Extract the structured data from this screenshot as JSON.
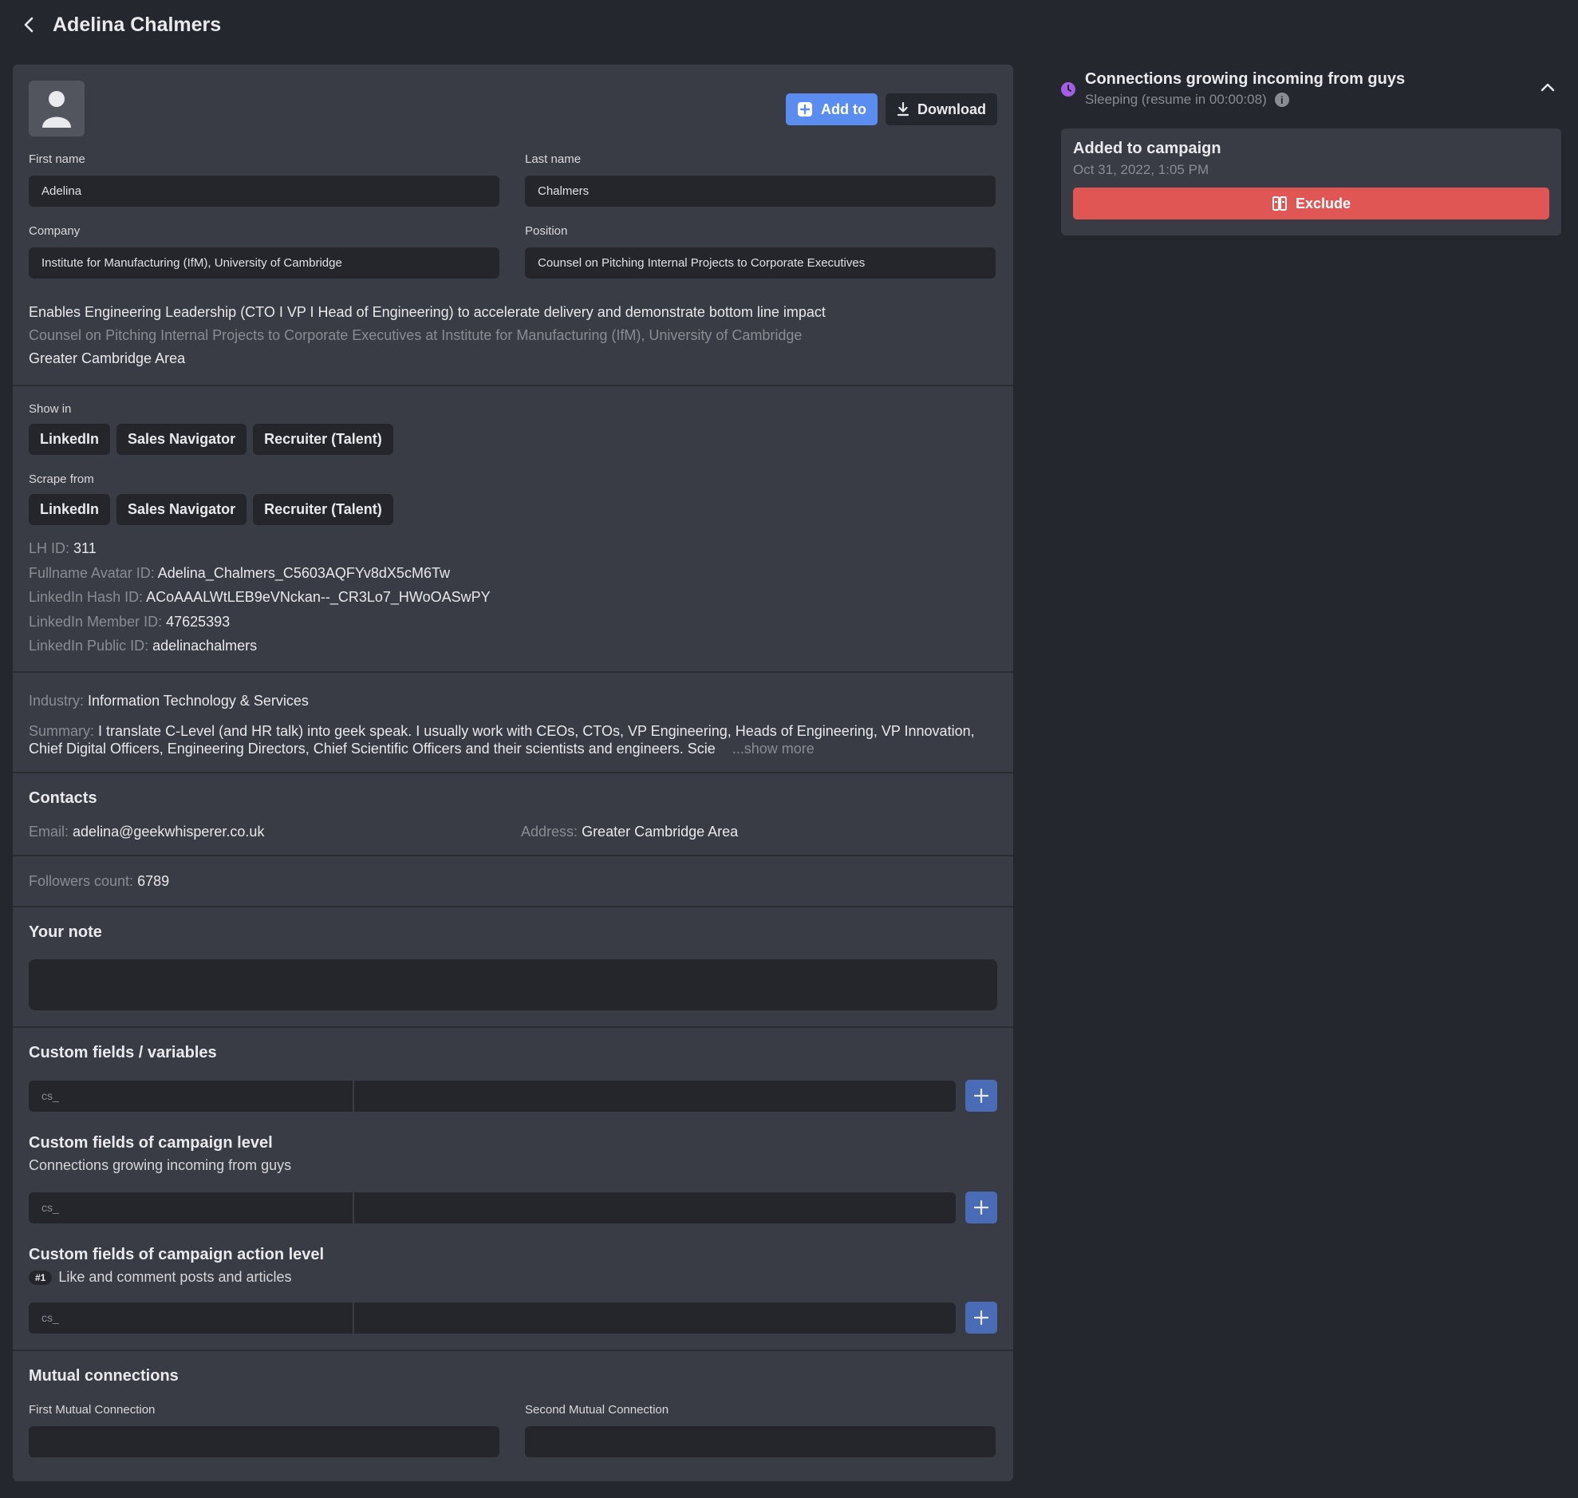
{
  "header": {
    "title": "Adelina Chalmers"
  },
  "profile": {
    "buttons": {
      "add_to": "Add to",
      "download": "Download"
    },
    "first_name": {
      "label": "First name",
      "value": "Adelina"
    },
    "last_name": {
      "label": "Last name",
      "value": "Chalmers"
    },
    "company": {
      "label": "Company",
      "value": "Institute for Manufacturing (IfM), University of Cambridge"
    },
    "position": {
      "label": "Position",
      "value": "Counsel  on Pitching Internal Projects to Corporate Executives"
    },
    "headline": "Enables Engineering Leadership (CTO I VP I Head of Engineering) to accelerate delivery and demonstrate bottom line impact",
    "subheadline": "Counsel on Pitching Internal Projects to Corporate Executives at Institute for Manufacturing (IfM), University of Cambridge",
    "location": "Greater Cambridge Area"
  },
  "show_in": {
    "label": "Show in",
    "tags": [
      "LinkedIn",
      "Sales Navigator",
      "Recruiter (Talent)"
    ]
  },
  "scrape_from": {
    "label": "Scrape from",
    "tags": [
      "LinkedIn",
      "Sales Navigator",
      "Recruiter (Talent)"
    ]
  },
  "ids": [
    {
      "key": "LH ID:",
      "value": "311"
    },
    {
      "key": "Fullname Avatar ID:",
      "value": "Adelina_Chalmers_C5603AQFYv8dX5cM6Tw"
    },
    {
      "key": "LinkedIn Hash ID:",
      "value": "ACoAAALWtLEB9eVNckan--_CR3Lo7_HWoOASwPY"
    },
    {
      "key": "LinkedIn Member ID:",
      "value": "47625393"
    },
    {
      "key": "LinkedIn Public ID:",
      "value": "adelinachalmers"
    }
  ],
  "industry": {
    "key": "Industry:",
    "value": "Information Technology & Services"
  },
  "summary": {
    "key": "Summary:",
    "value": "I translate C-Level (and HR talk) into geek speak. I usually work with CEOs, CTOs, VP Engineering, Heads of Engineering, VP Innovation, Chief Digital Officers, Engineering Directors, Chief Scientific Officers and their scientists and engineers. Scie",
    "show_more": "...show more"
  },
  "contacts": {
    "title": "Contacts",
    "email_key": "Email:",
    "email": "adelina@geekwhisperer.co.uk",
    "address_key": "Address:",
    "address": "Greater Cambridge Area"
  },
  "followers": {
    "key": "Followers count:",
    "value": "6789"
  },
  "note": {
    "title": "Your note"
  },
  "custom_fields": {
    "title": "Custom fields / variables",
    "key_placeholder": "cs_",
    "campaign_title": "Custom fields of campaign level",
    "campaign_name": "Connections growing incoming from guys",
    "action_title": "Custom fields of campaign action level",
    "action_badge": "#1",
    "action_name": "Like and comment posts and articles"
  },
  "mutual": {
    "title": "Mutual connections",
    "first_label": "First Mutual Connection",
    "second_label": "Second Mutual Connection"
  },
  "sidebar": {
    "campaign_title": "Connections growing incoming from guys",
    "status": "Sleeping (resume in 00:00:08)",
    "card_title": "Added to campaign",
    "card_date": "Oct 31, 2022, 1:05 PM",
    "exclude": "Exclude",
    "colors": {
      "accent": "#5b8cf0",
      "danger": "#e05655",
      "status": "#a45ee5"
    }
  }
}
